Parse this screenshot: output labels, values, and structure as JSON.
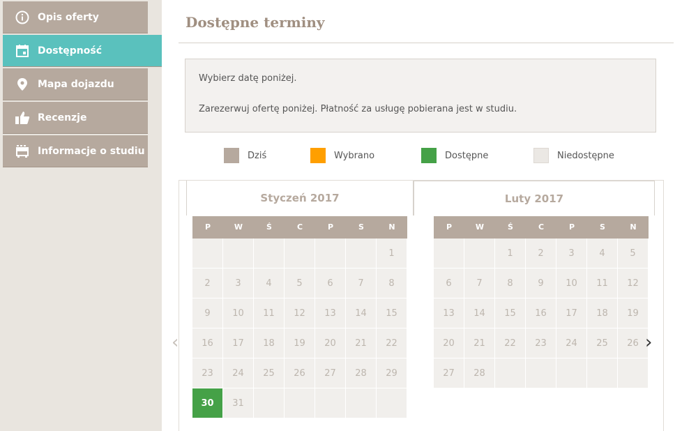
{
  "sidebar": {
    "items": [
      {
        "label": "Opis oferty",
        "icon": "info-icon"
      },
      {
        "label": "Dostępność",
        "icon": "calendar-icon",
        "active": true
      },
      {
        "label": "Mapa dojazdu",
        "icon": "map-pin-icon"
      },
      {
        "label": "Recenzje",
        "icon": "thumbs-up-icon"
      },
      {
        "label": "Informacje o studiu",
        "icon": "bus-icon"
      }
    ]
  },
  "main": {
    "title": "Dostępne terminy",
    "info": {
      "line1": "Wybierz datę poniżej.",
      "line2": "Zarezerwuj ofertę poniżej. Płatność za usługę pobierana jest w studiu."
    },
    "legend": [
      {
        "label": "Dziś",
        "color": "#b6a99e"
      },
      {
        "label": "Wybrano",
        "color": "#ff9f00"
      },
      {
        "label": "Dostępne",
        "color": "#45a147"
      },
      {
        "label": "Niedostępne",
        "color": "#ebe8e4"
      }
    ]
  },
  "calendar": {
    "weekdays": [
      "P",
      "W",
      "Ś",
      "C",
      "P",
      "S",
      "N"
    ],
    "months": [
      {
        "title": "Styczeń 2017",
        "weeks": [
          [
            "",
            "",
            "",
            "",
            "",
            "",
            "1"
          ],
          [
            "2",
            "3",
            "4",
            "5",
            "6",
            "7",
            "8"
          ],
          [
            "9",
            "10",
            "11",
            "12",
            "13",
            "14",
            "15"
          ],
          [
            "16",
            "17",
            "18",
            "19",
            "20",
            "21",
            "22"
          ],
          [
            "23",
            "24",
            "25",
            "26",
            "27",
            "28",
            "29"
          ],
          [
            "30",
            "31",
            "",
            "",
            "",
            "",
            ""
          ]
        ],
        "available_days": [
          "30"
        ]
      },
      {
        "title": "Luty 2017",
        "weeks": [
          [
            "",
            "",
            "1",
            "2",
            "3",
            "4",
            "5"
          ],
          [
            "6",
            "7",
            "8",
            "9",
            "10",
            "11",
            "12"
          ],
          [
            "13",
            "14",
            "15",
            "16",
            "17",
            "18",
            "19"
          ],
          [
            "20",
            "21",
            "22",
            "23",
            "24",
            "25",
            "26"
          ],
          [
            "27",
            "28",
            "",
            "",
            "",
            "",
            ""
          ]
        ],
        "available_days": []
      }
    ],
    "prev_icon": "chevron-left-icon",
    "next_icon": "chevron-right-icon"
  }
}
